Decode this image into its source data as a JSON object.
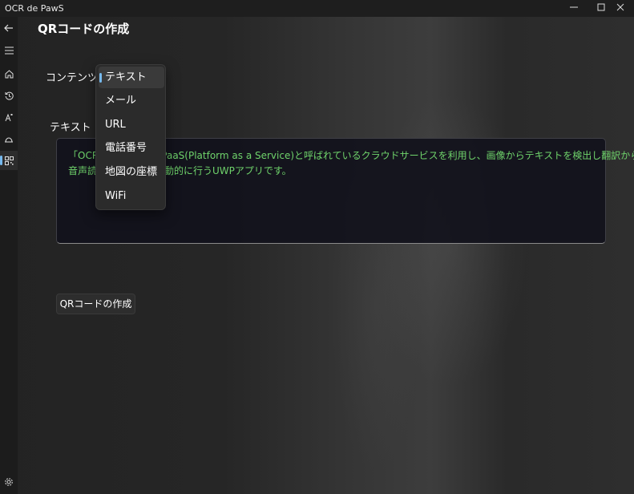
{
  "app": {
    "title": "OCR de PawS",
    "window_controls": [
      "minimize-icon",
      "maximize-icon",
      "close-icon"
    ]
  },
  "nav": {
    "items": [
      {
        "icon": "back-arrow-icon"
      },
      {
        "icon": "hamburger-menu-icon"
      },
      {
        "icon": "home-icon"
      },
      {
        "icon": "history-icon"
      },
      {
        "icon": "translate-icon"
      },
      {
        "icon": "speaker-icon"
      },
      {
        "icon": "qr-code-icon",
        "active": true
      },
      {
        "icon": "gear-icon"
      }
    ],
    "accent": "#76b9ed"
  },
  "page": {
    "title": "QRコードの作成",
    "content_label": "コンテンツ",
    "text_label": "テキスト",
    "text_lines": [
      "「OCR de PawS」はPaaS(Platform as a Service)と呼ばれているクラウドサービスを利用し、画像からテキストを検出し翻訳から",
      "音声読み上げまでを自動的に行うUWPアプリです。"
    ],
    "text_color": "#6fd36b",
    "create_button": "QRコードの作成"
  },
  "dropdown": {
    "selected": "テキスト",
    "options": [
      "テキスト",
      "メール",
      "URL",
      "電話番号",
      "地図の座標",
      "WiFi"
    ]
  }
}
